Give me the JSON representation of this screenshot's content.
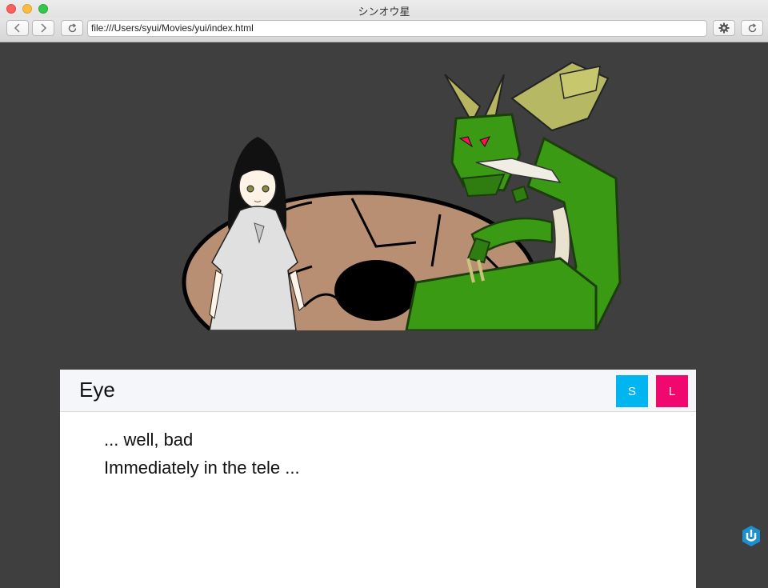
{
  "window": {
    "title": "シンオウ星"
  },
  "toolbar": {
    "url": "file:///Users/syui/Movies/yui/index.html"
  },
  "dialog": {
    "speaker": "Eye",
    "save_label": "S",
    "load_label": "L",
    "lines": [
      "... well, bad",
      "Immediately in the tele ..."
    ]
  },
  "colors": {
    "save_button": "#00b5f0",
    "load_button": "#f0086e",
    "stage_background": "#3f3f3f",
    "dragon_green": "#3a9a14"
  },
  "icons": [
    "back-icon",
    "forward-icon",
    "reload-icon",
    "gear-icon",
    "refresh-icon",
    "app-logo-icon"
  ]
}
